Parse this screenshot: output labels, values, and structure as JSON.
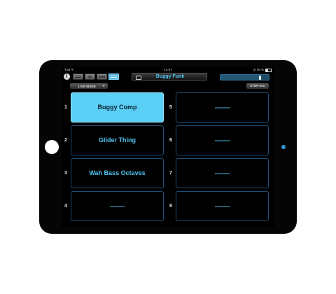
{
  "status_bar": {
    "carrier": "Ÿod ᯤ",
    "time": "14:57",
    "battery_text": "◎ 39 %"
  },
  "toolbar": {
    "info_glyph": "i",
    "view_buttons": [
      "list-view",
      "browse-view",
      "grid-view",
      "live-view"
    ],
    "active_view": "live-view",
    "setlist_title": "Buggy Funk",
    "volume_level": 0.82
  },
  "mode": {
    "label": "LIVE MODE"
  },
  "stop_all_label": "STOP ALL",
  "presets": [
    {
      "number": "1",
      "name": "Buggy Comp",
      "active": true
    },
    {
      "number": "2",
      "name": "Glider Thing",
      "active": false
    },
    {
      "number": "3",
      "name": "Wah Bass Octaves",
      "active": false
    },
    {
      "number": "4",
      "name": "----------",
      "active": false
    },
    {
      "number": "5",
      "name": "----------",
      "active": false
    },
    {
      "number": "6",
      "name": "----------",
      "active": false
    },
    {
      "number": "7",
      "name": "----------",
      "active": false
    },
    {
      "number": "8",
      "name": "----------",
      "active": false
    }
  ],
  "colors": {
    "accent": "#4ec3ee",
    "active_slot": "#5ad0f6",
    "slot_border": "#1f4e74"
  }
}
